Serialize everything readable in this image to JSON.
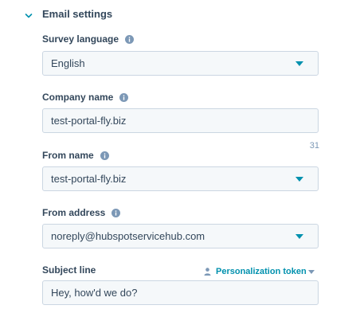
{
  "section": {
    "title": "Email settings"
  },
  "fields": {
    "survey_language": {
      "label": "Survey language",
      "value": "English"
    },
    "company_name": {
      "label": "Company name",
      "value": "test-portal-fly.biz",
      "char_count": "31"
    },
    "from_name": {
      "label": "From name",
      "value": "test-portal-fly.biz"
    },
    "from_address": {
      "label": "From address",
      "value": "noreply@hubspotservicehub.com"
    },
    "subject_line": {
      "label": "Subject line",
      "value": "Hey, how'd we do?",
      "token_link": "Personalization token"
    }
  },
  "colors": {
    "accent": "#0091ae",
    "text": "#33475b",
    "input_bg": "#f5f8fa",
    "input_border": "#cbd6e2"
  }
}
